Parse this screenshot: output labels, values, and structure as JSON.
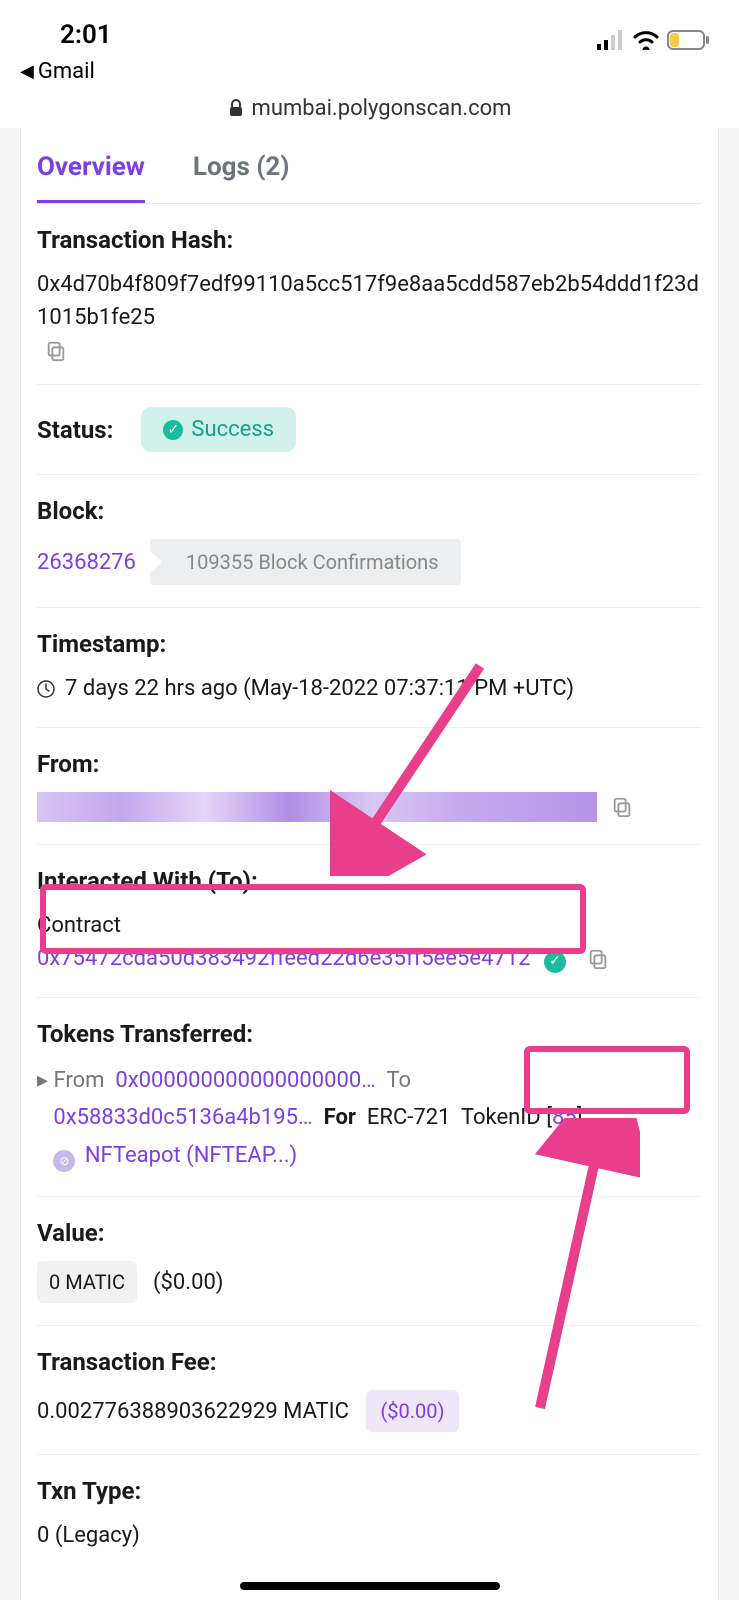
{
  "statusbar": {
    "time": "2:01"
  },
  "back_app": "Gmail",
  "address": "mumbai.polygonscan.com",
  "tabs": {
    "overview": "Overview",
    "logs": "Logs (2)"
  },
  "rows": {
    "txhash": {
      "label": "Transaction Hash:",
      "value": "0x4d70b4f809f7edf99110a5cc517f9e8aa5cdd587eb2b54ddd1f23d1015b1fe25"
    },
    "status": {
      "label": "Status:",
      "value": "Success"
    },
    "block": {
      "label": "Block:",
      "number": "26368276",
      "confirmations": "109355 Block Confirmations"
    },
    "timestamp": {
      "label": "Timestamp:",
      "value": "7 days 22 hrs ago (May-18-2022 07:37:11 PM +UTC)"
    },
    "from": {
      "label": "From:"
    },
    "interacted": {
      "label": "Interacted With (To):",
      "prefix": "Contract",
      "address": "0x75472cda50d383492ffeed22d6e35ff5ee5e4712"
    },
    "tokens": {
      "label": "Tokens Transferred:",
      "from_label": "From",
      "from_addr": "0x000000000000000000…",
      "to_label": "To",
      "to_addr": "0x58833d0c5136a4b195…",
      "for_label": "For",
      "standard": "ERC-721",
      "tokenid_label": "TokenID",
      "tokenid": "85",
      "tokenname": "NFTeapot (NFTEAP...)"
    },
    "value": {
      "label": "Value:",
      "amount": "0 MATIC",
      "usd": "($0.00)"
    },
    "fee": {
      "label": "Transaction Fee:",
      "amount": "0.002776388903622929 MATIC",
      "usd": "($0.00)"
    },
    "txntype": {
      "label": "Txn Type:",
      "value": "0 (Legacy)"
    }
  }
}
